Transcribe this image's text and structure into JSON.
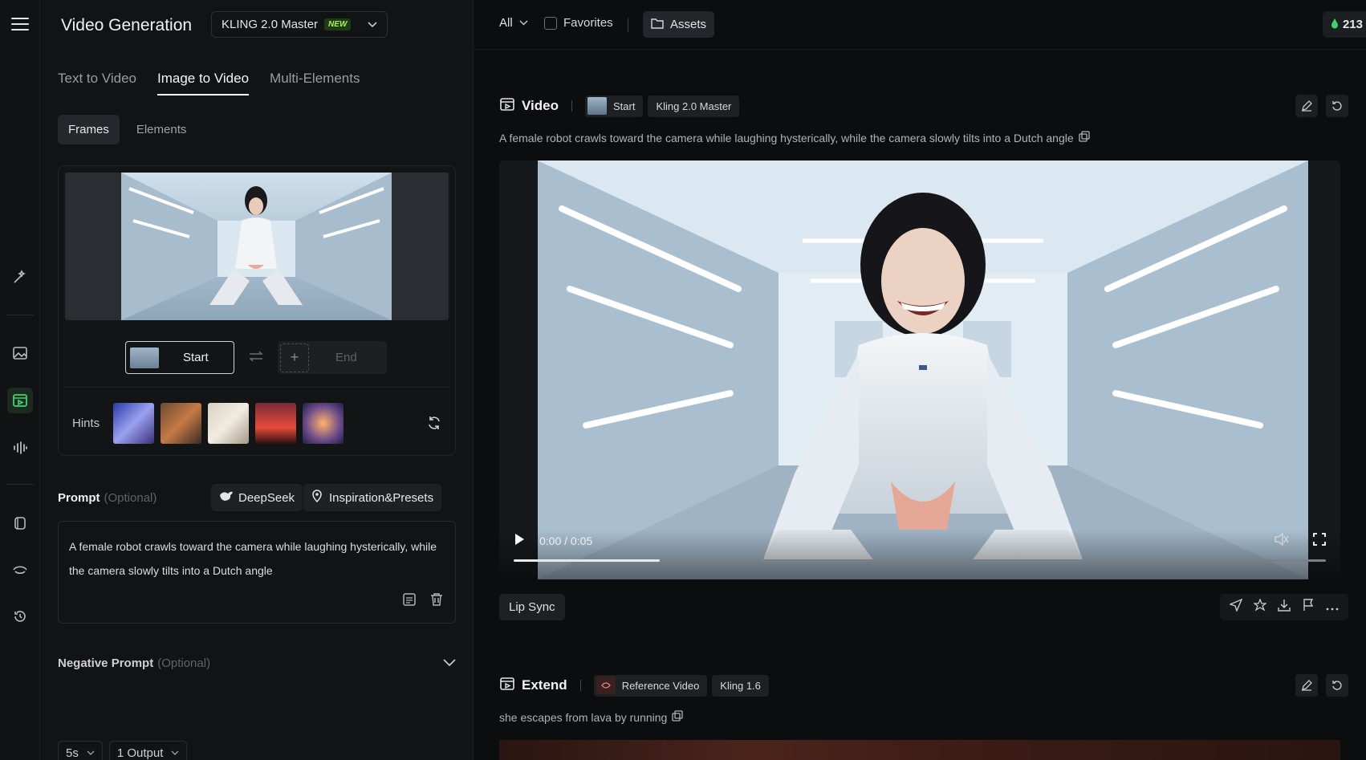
{
  "sidebar": {
    "icons": [
      "menu-icon",
      "magic-wand-icon",
      "image-icon",
      "video-icon",
      "audio-icon",
      "effects-icon",
      "eye-icon",
      "history-icon"
    ]
  },
  "header": {
    "title": "Video Generation",
    "model": "KLING 2.0 Master",
    "model_badge": "NEW"
  },
  "mode_tabs": [
    {
      "label": "Text to Video",
      "active": false
    },
    {
      "label": "Image to Video",
      "active": true
    },
    {
      "label": "Multi-Elements",
      "active": false
    }
  ],
  "sub_tabs": [
    {
      "label": "Frames",
      "active": true
    },
    {
      "label": "Elements",
      "active": false
    }
  ],
  "frames": {
    "start_label": "Start",
    "end_label": "End",
    "hints_label": "Hints",
    "hint_count": 5
  },
  "prompt": {
    "label": "Prompt",
    "optional": "(Optional)",
    "deepseek_label": "DeepSeek",
    "inspiration_label": "Inspiration&Presets",
    "text": "A female robot crawls toward the camera while laughing hysterically, while the camera slowly tilts into a Dutch angle"
  },
  "negative_prompt": {
    "label": "Negative Prompt",
    "optional": "(Optional)"
  },
  "settings": {
    "duration": "5s",
    "outputs": "1 Output"
  },
  "topbar": {
    "filter": "All",
    "favorites_label": "Favorites",
    "assets_label": "Assets",
    "credits": "213"
  },
  "video_card": {
    "title": "Video",
    "start_chip": "Start",
    "model_chip": "Kling 2.0 Master",
    "description": "A female robot crawls toward the camera while laughing hysterically, while the camera slowly tilts into a Dutch angle",
    "time": "0:00 / 0:05",
    "progress": 0.18,
    "lip_sync_label": "Lip Sync"
  },
  "extend_card": {
    "title": "Extend",
    "reference_chip": "Reference Video",
    "model_chip": "Kling 1.6",
    "description": "she escapes from lava by running"
  },
  "colors": {
    "accent_green": "#3fd36b",
    "panel_bg": "#111315",
    "page_bg": "#0b0d0f"
  }
}
